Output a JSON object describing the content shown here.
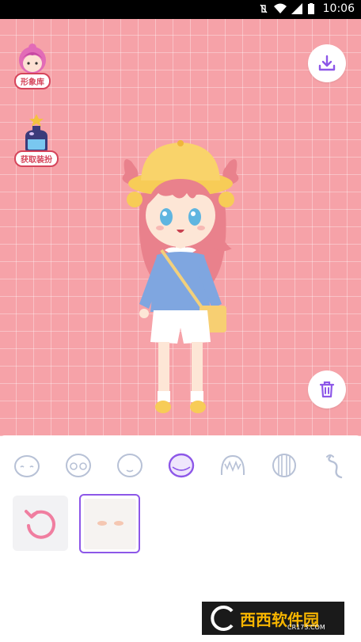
{
  "status_bar": {
    "time": "10:06"
  },
  "side_buttons": {
    "avatar_library_label": "形象库",
    "get_outfit_label": "获取装扮"
  },
  "categories": [
    "face-base-icon",
    "face-shape-icon",
    "face-mouth-icon",
    "face-selected-icon",
    "bangs-icon",
    "back-hair-icon",
    "hair-accessory-icon"
  ],
  "colors": {
    "canvas_bg": "#f6a2a8",
    "accent_purple": "#8d57e8",
    "label_red": "#d6455b",
    "undo_pink": "#f07ea0"
  },
  "watermark": {
    "brand": "西西软件园",
    "domain": "CR173.COM"
  }
}
